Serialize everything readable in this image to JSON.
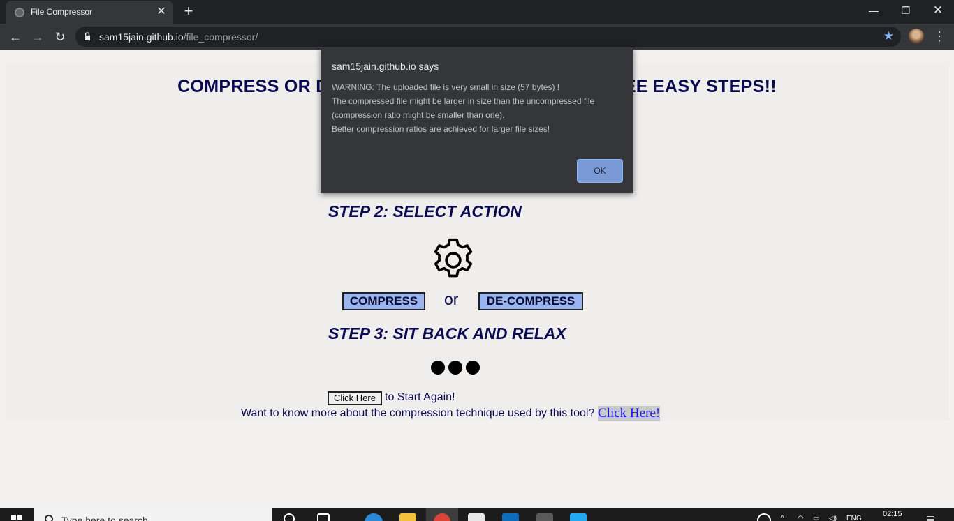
{
  "browser": {
    "tab_title": "File Compressor",
    "url_host": "sam15jain.github.io",
    "url_path": "/file_compressor/"
  },
  "page": {
    "heading": "COMPRESS OR DE-COMPRESS YOUR FILES IN THREE EASY STEPS!!",
    "step2": "STEP 2: SELECT  ACTION",
    "compress_label": "COMPRESS",
    "or_label": "or",
    "decompress_label": "DE-COMPRESS",
    "step3": "STEP 3: SIT BACK AND RELAX",
    "restart_button": "Click Here",
    "restart_text": "to Start Again!",
    "learn_text": "Want to know more about the compression technique used by this tool?",
    "learn_link": "Click Here!"
  },
  "dialog": {
    "origin": "sam15jain.github.io says",
    "line1": "WARNING: The uploaded file is very small in size (57 bytes) !",
    "line2": "The compressed file might be larger in size than the uncompressed file",
    "line3": "(compression ratio might be smaller than one).",
    "line4": "Better compression ratios are achieved for larger file sizes!",
    "ok_label": "OK"
  },
  "taskbar": {
    "search_placeholder": "Type here to search",
    "language": "ENG",
    "time": "02:15"
  },
  "icons": {
    "tab_favicon": "globe-icon",
    "gear": "gear-icon",
    "bookmark": "star-icon"
  },
  "colors": {
    "heading": "#0a0a50",
    "action_button": "#9ab4f0",
    "dialog_bg": "#35363a",
    "ok_button": "#7a9ad6"
  }
}
